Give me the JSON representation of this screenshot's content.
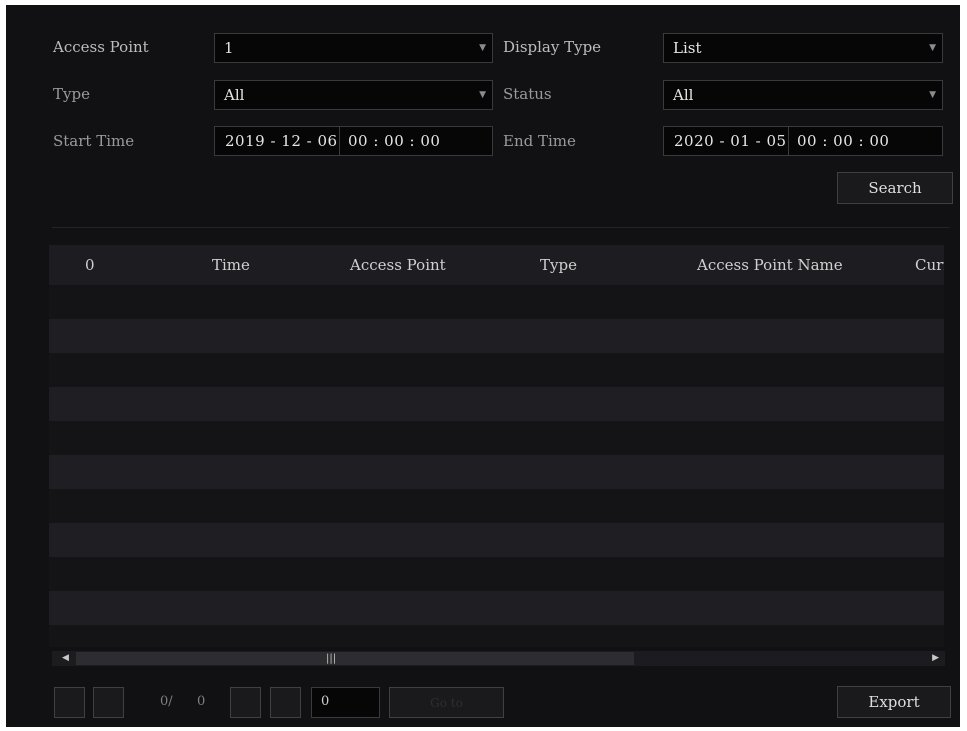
{
  "filters": {
    "access_point": {
      "label": "Access Point",
      "value": "1"
    },
    "display_type": {
      "label": "Display Type",
      "value": "List"
    },
    "type": {
      "label": "Type",
      "value": "All"
    },
    "status": {
      "label": "Status",
      "value": "All"
    },
    "start_time": {
      "label": "Start Time",
      "date": "2019 - 12 - 06",
      "time": "00 : 00 : 00"
    },
    "end_time": {
      "label": "End Time",
      "date": "2020 - 01 - 05",
      "time": "00 : 00 : 00"
    }
  },
  "search_button": "Search",
  "table": {
    "columns": [
      "0",
      "Time",
      "Access Point",
      "Type",
      "Access Point Name",
      "Curr"
    ],
    "rows": []
  },
  "pagination": {
    "current": "0/",
    "total": "0",
    "goto_value": "0",
    "go_label": "Go to"
  },
  "export_button": "Export",
  "icons": {
    "dropdown": "triangle-down-icon",
    "scroll_left": "triangle-left-icon",
    "scroll_right": "triangle-right-icon"
  }
}
